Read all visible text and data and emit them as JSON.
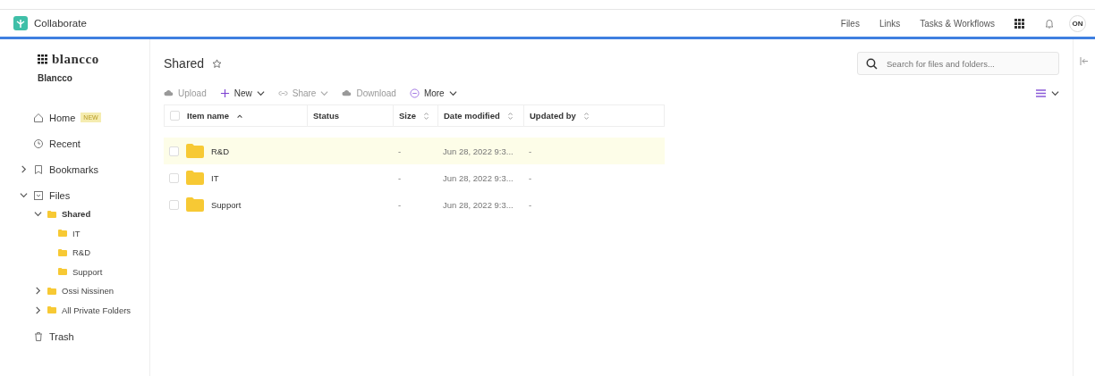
{
  "app": {
    "title": "Collaborate"
  },
  "top_nav": [
    {
      "label": "Files"
    },
    {
      "label": "Links"
    },
    {
      "label": "Tasks & Workflows"
    }
  ],
  "avatar": "ON",
  "org": {
    "logo": "blancco",
    "name": "Blancco"
  },
  "sidebar": {
    "items": [
      {
        "label": "Home",
        "kind": "home",
        "badge": "NEW"
      },
      {
        "label": "Recent",
        "kind": "recent"
      },
      {
        "label": "Bookmarks",
        "kind": "bookmarks",
        "expanded": false
      },
      {
        "label": "Files",
        "kind": "files",
        "expanded": true,
        "children": [
          {
            "label": "Shared",
            "expanded": true,
            "selected": true,
            "children": [
              {
                "label": "IT",
                "selected": false
              },
              {
                "label": "R&D",
                "selected": false
              },
              {
                "label": "Support",
                "selected": false
              }
            ]
          },
          {
            "label": "Ossi Nissinen",
            "expanded": false,
            "selected": false
          },
          {
            "label": "All Private Folders",
            "expanded": false,
            "selected": false
          }
        ]
      },
      {
        "label": "Trash",
        "kind": "trash"
      }
    ]
  },
  "page": {
    "title": "Shared"
  },
  "search": {
    "placeholder": "Search for files and folders..."
  },
  "toolbar": [
    {
      "label": "Upload",
      "kind": "upload",
      "disabled": true,
      "menu": false
    },
    {
      "label": "New",
      "kind": "plus",
      "disabled": false,
      "menu": true
    },
    {
      "label": "Share",
      "kind": "link",
      "disabled": true,
      "menu": true
    },
    {
      "label": "Download",
      "kind": "download",
      "disabled": true,
      "menu": false
    },
    {
      "label": "More",
      "kind": "more",
      "disabled": false,
      "menu": true
    }
  ],
  "table": {
    "select_all": {
      "checked": false
    },
    "columns": [
      {
        "label": "Item name",
        "kind": "sorted_ascending"
      },
      {
        "label": "Status",
        "kind": "plain"
      },
      {
        "label": "Size",
        "kind": "sortable"
      },
      {
        "label": "Date modified",
        "kind": "sortable"
      },
      {
        "label": "Updated by",
        "kind": "sortable"
      }
    ],
    "rows": [
      {
        "name": "R&D",
        "size": "-",
        "date": "Jun 28, 2022 9:3...",
        "updated_by": "-",
        "selected": true,
        "checked": false
      },
      {
        "name": "IT",
        "size": "-",
        "date": "Jun 28, 2022 9:3...",
        "updated_by": "-",
        "selected": false,
        "checked": false
      },
      {
        "name": "Support",
        "size": "-",
        "date": "Jun 28, 2022 9:3...",
        "updated_by": "-",
        "selected": false,
        "checked": false
      }
    ]
  }
}
